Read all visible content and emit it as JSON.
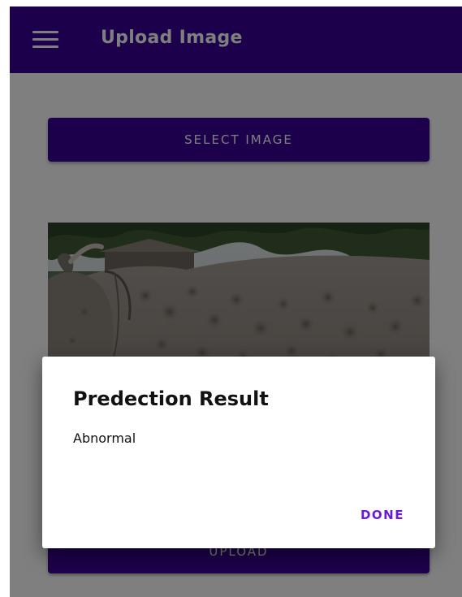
{
  "app_bar": {
    "title": "Upload Image",
    "menu_icon": "menu-icon"
  },
  "main": {
    "select_button_label": "SELECT IMAGE",
    "upload_button_label": "UPLOAD"
  },
  "dialog": {
    "title": "Predection Result",
    "message": "Abnormal",
    "action_label": "DONE"
  },
  "colors": {
    "primary": "#3a0096",
    "accent": "#6a1bd8",
    "scrim": "#000000"
  }
}
